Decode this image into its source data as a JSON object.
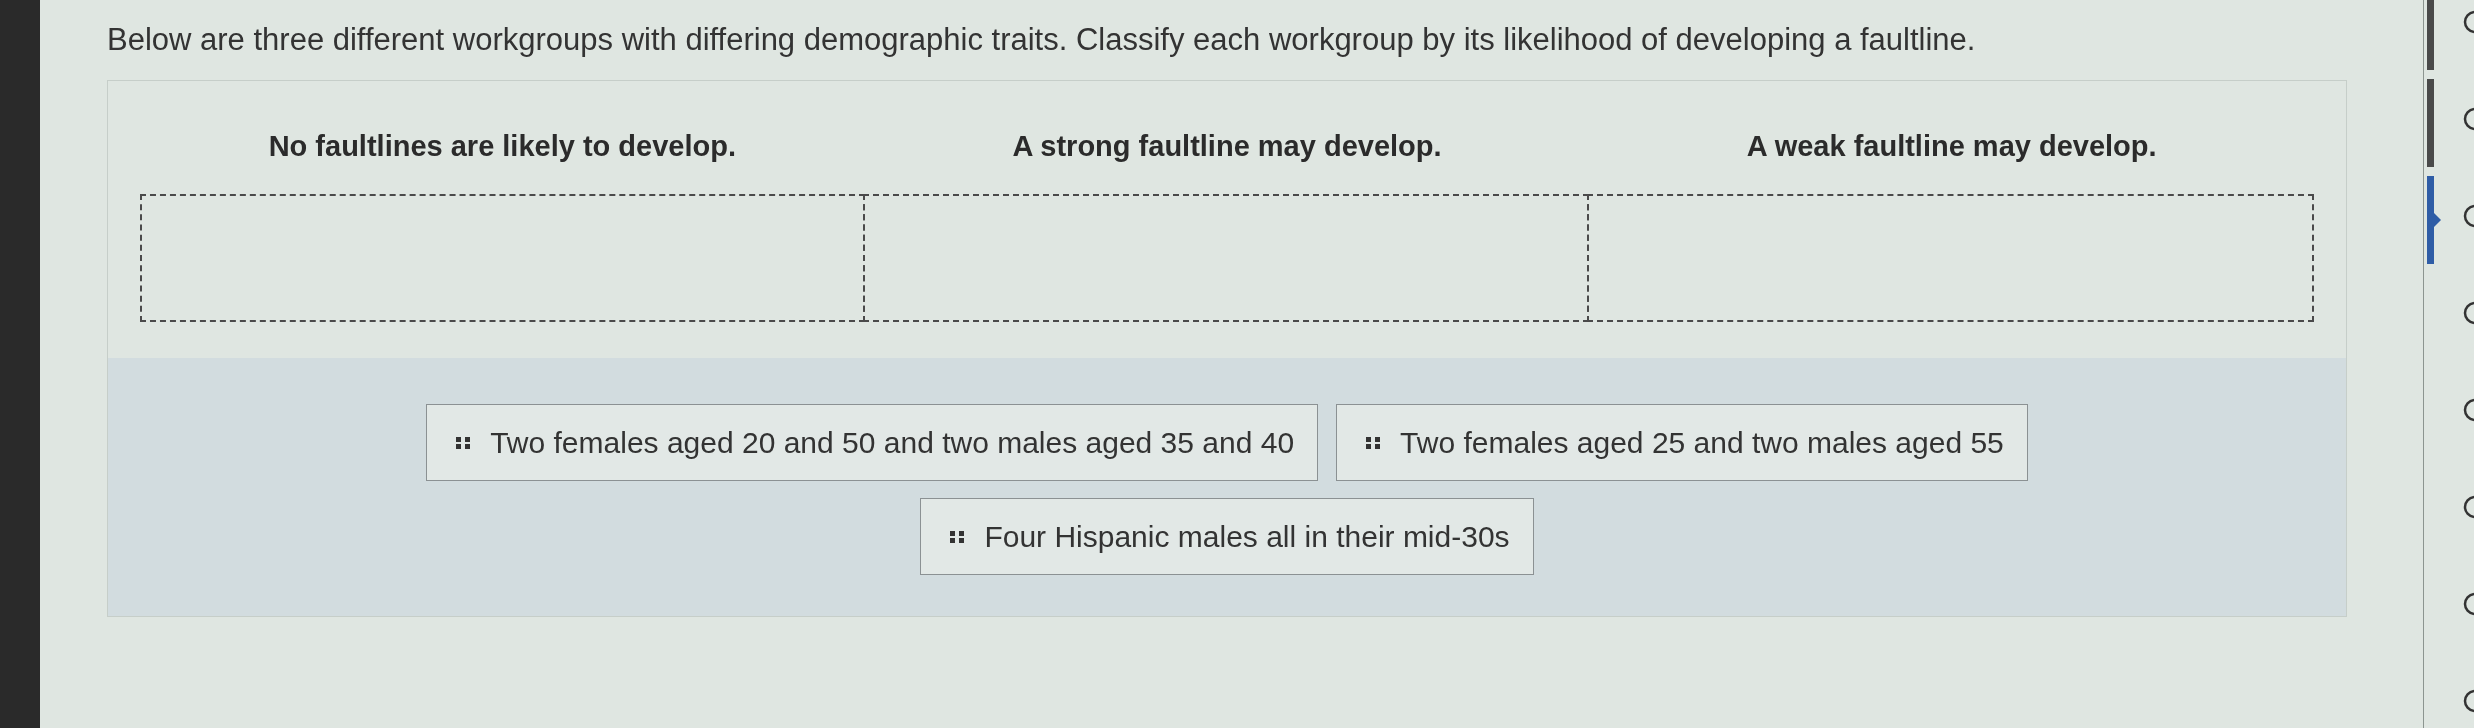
{
  "instruction": "Below are three different workgroups with differing demographic traits. Classify each workgroup by its likelihood of developing a faultline.",
  "categories": [
    {
      "heading": "No faultlines are likely to develop."
    },
    {
      "heading": "A strong faultline may develop."
    },
    {
      "heading": "A weak faultline may develop."
    }
  ],
  "answer_bank": [
    {
      "text": "Two females aged 20 and 50 and two males aged 35 and 40"
    },
    {
      "text": "Two females aged 25 and two males aged 55"
    },
    {
      "text": "Four Hispanic males all in their mid-30s"
    }
  ],
  "question_nav": [
    {
      "visited": true,
      "selected": false
    },
    {
      "visited": true,
      "selected": false
    },
    {
      "visited": true,
      "selected": true
    },
    {
      "visited": false,
      "selected": false
    },
    {
      "visited": false,
      "selected": false
    },
    {
      "visited": false,
      "selected": false
    },
    {
      "visited": false,
      "selected": false
    },
    {
      "visited": false,
      "selected": false
    }
  ]
}
